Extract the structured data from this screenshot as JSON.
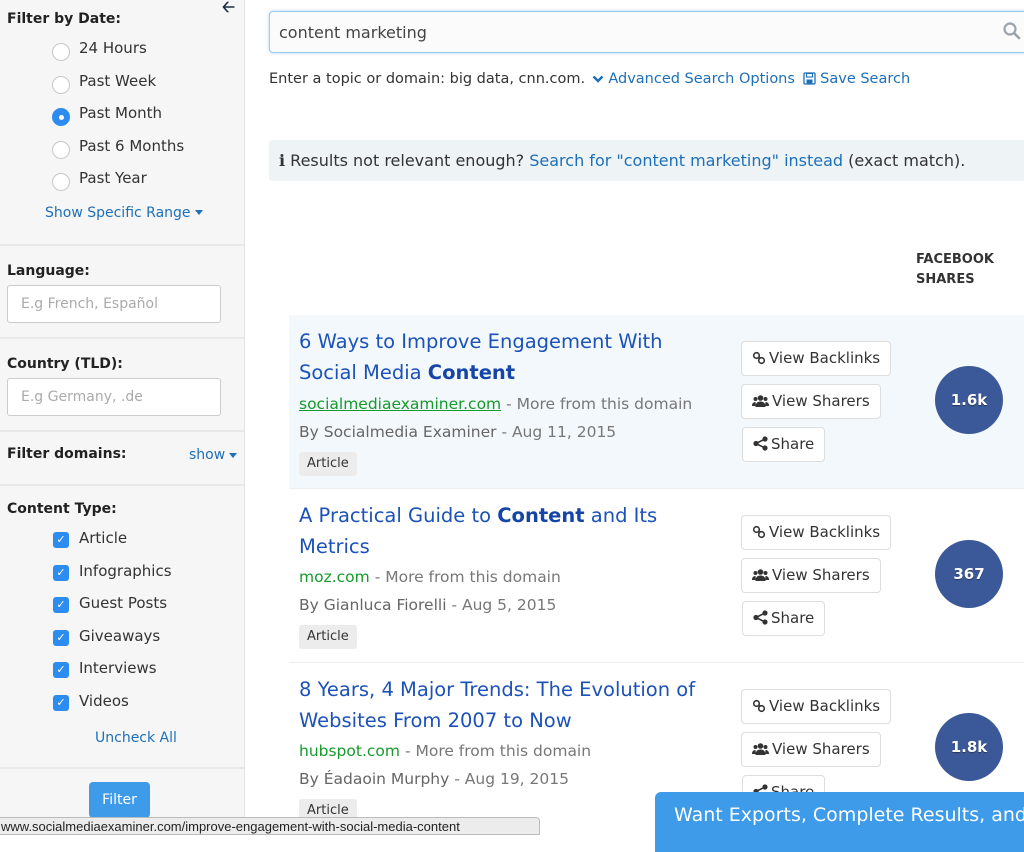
{
  "sidebar": {
    "collapse_icon": "arrow-left-icon",
    "date_filter": {
      "title": "Filter by Date:",
      "options": [
        {
          "label": "24 Hours",
          "selected": false
        },
        {
          "label": "Past Week",
          "selected": false
        },
        {
          "label": "Past Month",
          "selected": true
        },
        {
          "label": "Past 6 Months",
          "selected": false
        },
        {
          "label": "Past Year",
          "selected": false
        }
      ],
      "range_link": "Show Specific Range"
    },
    "language": {
      "title": "Language:",
      "placeholder": "E.g French, Español",
      "value": ""
    },
    "country": {
      "title": "Country (TLD):",
      "placeholder": "E.g Germany, .de",
      "value": ""
    },
    "domains": {
      "title": "Filter domains:",
      "toggle": "show"
    },
    "content_type": {
      "title": "Content Type:",
      "options": [
        {
          "label": "Article",
          "checked": true
        },
        {
          "label": "Infographics",
          "checked": true
        },
        {
          "label": "Guest Posts",
          "checked": true
        },
        {
          "label": "Giveaways",
          "checked": true
        },
        {
          "label": "Interviews",
          "checked": true
        },
        {
          "label": "Videos",
          "checked": true
        }
      ],
      "uncheck_all": "Uncheck All"
    },
    "filter_button": "Filter"
  },
  "search": {
    "value": "content marketing",
    "hint": "Enter a topic or domain: big data, cnn.com.",
    "advanced_link": "Advanced Search Options",
    "save_link": "Save Search"
  },
  "info": {
    "prefix": "Results not relevant enough?",
    "link": "Search for \"content marketing\" instead",
    "suffix": "(exact match)."
  },
  "columns": {
    "facebook_line1": "FACEBOOK",
    "facebook_line2": "SHARES"
  },
  "results": [
    {
      "title_pre": "6 Ways to Improve Engagement With Social Media ",
      "title_bold": "Content",
      "title_post": "",
      "domain": "socialmediaexaminer.com",
      "more": "- More from this domain",
      "author": "By Socialmedia Examiner",
      "date": "- Aug 11, 2015",
      "type": "Article",
      "facebook_shares": "1.6k"
    },
    {
      "title_pre": "A Practical Guide to ",
      "title_bold": "Content",
      "title_post": " and Its Metrics",
      "domain": "moz.com",
      "more": "- More from this domain",
      "author": "By Gianluca Fiorelli",
      "date": "- Aug 5, 2015",
      "type": "Article",
      "facebook_shares": "367"
    },
    {
      "title_pre": "8 Years, 4 Major Trends: The Evolution of Websites From 2007 to Now",
      "title_bold": "",
      "title_post": "",
      "domain": "hubspot.com",
      "more": "- More from this domain",
      "author": "By Éadaoin Murphy",
      "date": "- Aug 19, 2015",
      "type": "Article",
      "facebook_shares": "1.8k"
    }
  ],
  "actions": {
    "backlinks": "View Backlinks",
    "sharers": "View Sharers",
    "share": "Share"
  },
  "status_url": "www.socialmediaexaminer.com/improve-engagement-with-social-media-content",
  "upsell": "Want Exports, Complete Results, and",
  "colors": {
    "accent": "#3d9be9",
    "link": "#1d6fb8",
    "title": "#1c52b8",
    "domain": "#159a2b",
    "facebook": "#3b5998"
  }
}
